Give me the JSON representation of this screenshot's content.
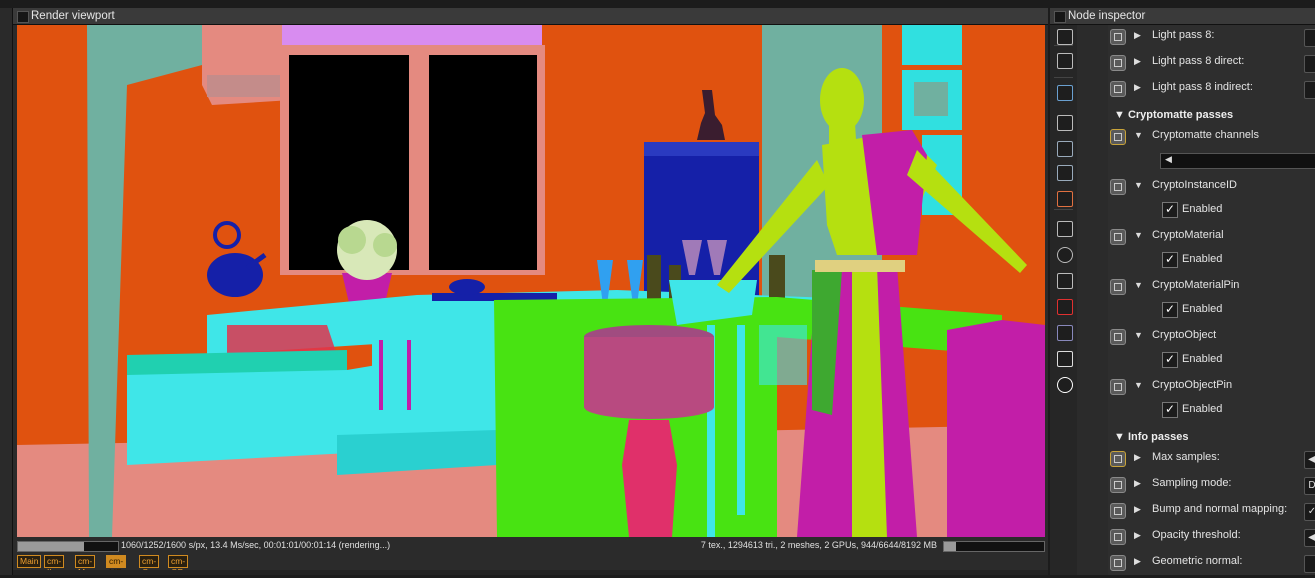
{
  "viewport": {
    "title": "Render viewport",
    "status_left": "1060/1252/1600 s/px, 13.4 Ms/sec, 00:01:01/00:01:14 (rendering...)",
    "status_right": "7 tex., 1294613 tri., 2 meshes, 2 GPUs, 944/6644/8192 MB",
    "progress_fraction": 0.66,
    "memory_fraction": 0.12,
    "tags": [
      {
        "label": "Main",
        "active": false
      },
      {
        "label": "cm-II",
        "active": false
      },
      {
        "label": "cm-M",
        "active": false
      },
      {
        "label": "cm-MP",
        "active": true
      },
      {
        "label": "cm-O",
        "active": false
      },
      {
        "label": "cm-OP",
        "active": false
      }
    ]
  },
  "inspector": {
    "title": "Node inspector",
    "tool_icons": [
      "node-graph-icon",
      "outliner-icon",
      "image-icon",
      "camera-icon",
      "database-icon",
      "database-add-icon",
      "material-icon",
      "frame-icon",
      "clock-icon",
      "transform-icon",
      "cube-icon",
      "layers-icon",
      "picture-icon",
      "sun-icon"
    ],
    "rows": {
      "lp8": "Light pass 8:",
      "lp8d": "Light pass 8 direct:",
      "lp8i": "Light pass 8 indirect:",
      "crypto_section": "Cryptomatte passes",
      "crypto_channels": "Cryptomatte channels",
      "instance_id": "CryptoInstanceID",
      "material": "CryptoMaterial",
      "material_pin": "CryptoMaterialPin",
      "object": "CryptoObject",
      "object_pin": "CryptoObjectPin",
      "enabled": "Enabled",
      "info_section": "Info passes",
      "max_samples": "Max samples:",
      "sampling_mode": "Sampling mode:",
      "sampling_mode_value": "D",
      "bump": "Bump and normal mapping:",
      "opacity": "Opacity threshold:",
      "geo_normal": "Geometric normal:"
    }
  },
  "colors": {
    "background_orange": "#e0520f",
    "cyan": "#3fe6e8",
    "green": "#48e312",
    "magenta": "#c21ea8",
    "lime": "#b5e010",
    "navy": "#1520a8",
    "pink": "#e48a80",
    "teal_grey": "#70b0a0",
    "accent_gold": "#d08a20"
  }
}
